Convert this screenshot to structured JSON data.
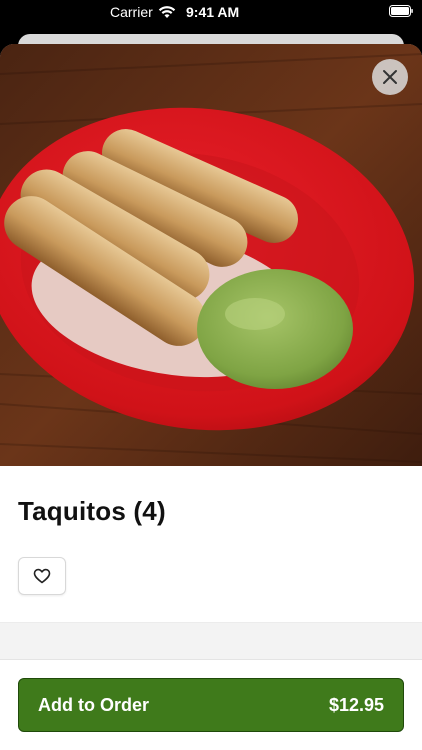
{
  "status_bar": {
    "carrier": "Carrier",
    "time": "9:41 AM"
  },
  "item": {
    "title": "Taquitos (4)",
    "image_icon": "taquitos-photo"
  },
  "actions": {
    "close_icon": "close-icon",
    "favorite_icon": "heart-icon",
    "add_label": "Add to Order",
    "price": "$12.95"
  },
  "colors": {
    "brand_green": "#3f7a1b",
    "button_border": "#1f4a0a"
  }
}
